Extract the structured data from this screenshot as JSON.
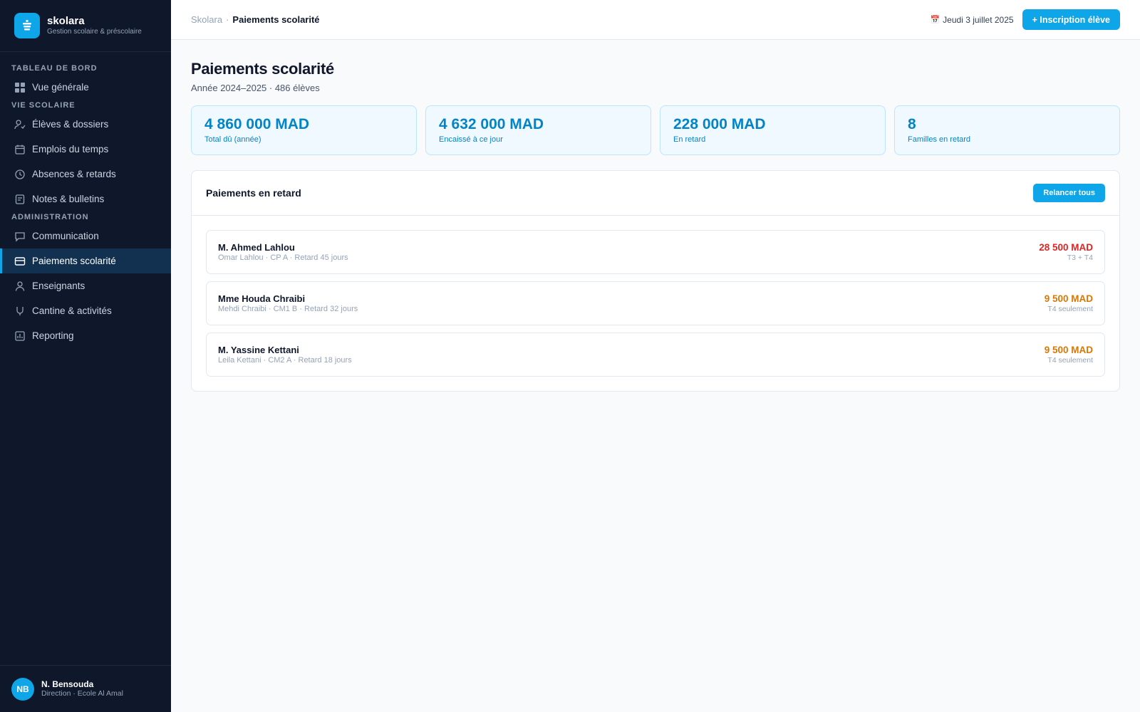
{
  "brand": {
    "name": "skolara",
    "subtitle": "Gestion scolaire & préscolaire"
  },
  "sidebar": {
    "sections": [
      {
        "label": "TABLEAU DE BORD",
        "items": [
          {
            "label": "Vue générale",
            "icon": "grid-icon"
          }
        ]
      },
      {
        "label": "VIE SCOLAIRE",
        "items": [
          {
            "label": "Élèves & dossiers",
            "icon": "user-check-icon"
          },
          {
            "label": "Emplois du temps",
            "icon": "calendar-icon"
          },
          {
            "label": "Absences & retards",
            "icon": "clock-icon"
          },
          {
            "label": "Notes & bulletins",
            "icon": "document-icon"
          }
        ]
      },
      {
        "label": "ADMINISTRATION",
        "items": [
          {
            "label": "Communication",
            "icon": "chat-icon"
          },
          {
            "label": "Paiements scolarité",
            "icon": "card-icon",
            "active": true
          },
          {
            "label": "Enseignants",
            "icon": "person-icon"
          },
          {
            "label": "Cantine & activités",
            "icon": "cup-icon"
          },
          {
            "label": "Reporting",
            "icon": "chart-icon"
          }
        ]
      }
    ]
  },
  "user": {
    "initials": "NB",
    "name": "N. Bensouda",
    "role": "Direction · Ecole Al Amal"
  },
  "topbar": {
    "breadcrumb_root": "Skolara",
    "breadcrumb_sep": "·",
    "breadcrumb_current": "Paiements scolarité",
    "date": "Jeudi 3 juillet 2025",
    "date_icon": "📅",
    "primary_button": "+ Inscription élève"
  },
  "page": {
    "title": "Paiements scolarité",
    "subtitle": "Année 2024–2025 · 486 élèves"
  },
  "stats": [
    {
      "value": "4 860 000 MAD",
      "label": "Total dû (année)"
    },
    {
      "value": "4 632 000 MAD",
      "label": "Encaissé à ce jour"
    },
    {
      "value": "228 000 MAD",
      "label": "En retard"
    },
    {
      "value": "8",
      "label": "Familles en retard"
    }
  ],
  "late_payments": {
    "title": "Paiements en retard",
    "button": "Relancer tous",
    "rows": [
      {
        "name": "M. Ahmed Lahlou",
        "detail": "Omar Lahlou · CP A · Retard 45 jours",
        "amount": "28 500 MAD",
        "note": "T3 + T4",
        "color": "#dc2626"
      },
      {
        "name": "Mme Houda Chraibi",
        "detail": "Mehdi Chraibi · CM1 B · Retard 32 jours",
        "amount": "9 500 MAD",
        "note": "T4 seulement",
        "color": "#d97706"
      },
      {
        "name": "M. Yassine Kettani",
        "detail": "Leila Kettani · CM2 A · Retard 18 jours",
        "amount": "9 500 MAD",
        "note": "T4 seulement",
        "color": "#d97706"
      }
    ]
  },
  "colors": {
    "accent": "#0ea5e9",
    "sidebar_bg": "#0f172a",
    "stat_text": "#0284c7"
  }
}
